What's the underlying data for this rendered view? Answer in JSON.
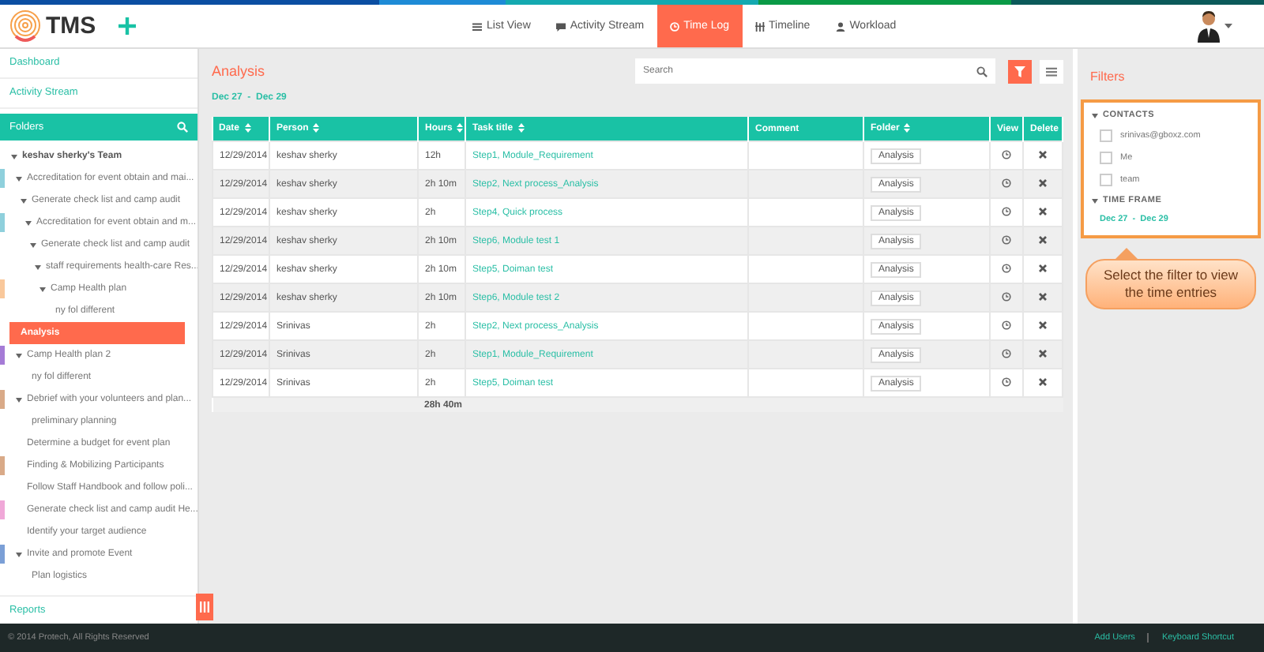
{
  "top_nav": {
    "logo_text": "TMS",
    "items": [
      {
        "label": "List View",
        "selected": false
      },
      {
        "label": "Activity Stream",
        "selected": false
      },
      {
        "label": "Time Log",
        "selected": true
      },
      {
        "label": "Timeline",
        "selected": false
      },
      {
        "label": "Workload",
        "selected": false
      }
    ]
  },
  "sidebar": {
    "links": [
      "Dashboard",
      "Activity Stream"
    ],
    "folders_title": "Folders",
    "tree": [
      {
        "label": "keshav sherky's Team",
        "expanded": true,
        "selected": false,
        "children": [
          {
            "label": "Accreditation for event obtain and mai...",
            "expanded": true,
            "selected": false,
            "color": "#8fd0dc",
            "children": [
              {
                "label": "Generate check list and camp audit",
                "expanded": true,
                "selected": false,
                "children": [
                  {
                    "label": "Accreditation for event obtain and m...",
                    "expanded": true,
                    "selected": false,
                    "color": "#8fd0dc",
                    "children": [
                      {
                        "label": "Generate check list and camp audit",
                        "expanded": true,
                        "selected": false,
                        "children": [
                          {
                            "label": "staff requirements health-care Res...",
                            "expanded": true,
                            "selected": false,
                            "children": [
                              {
                                "label": "Camp Health plan",
                                "expanded": true,
                                "selected": false,
                                "color": "#f9c89b",
                                "children": [
                                  {
                                    "label": "ny fol different",
                                    "selected": false
                                  },
                                  {
                                    "label": "Analysis",
                                    "selected": true
                                  }
                                ]
                              }
                            ]
                          }
                        ]
                      }
                    ]
                  }
                ]
              }
            ]
          },
          {
            "label": "Camp Health plan 2",
            "expanded": true,
            "selected": false,
            "color": "#a57bd6",
            "children": [
              {
                "label": "ny fol different",
                "selected": false
              }
            ]
          },
          {
            "label": "Debrief with your volunteers and plan...",
            "expanded": true,
            "selected": false,
            "color": "#d9aa88",
            "children": [
              {
                "label": "preliminary planning",
                "selected": false
              }
            ]
          },
          {
            "label": "Determine a budget for event plan",
            "selected": false
          },
          {
            "label": "Finding & Mobilizing Participants",
            "selected": false,
            "color": "#d9aa88"
          },
          {
            "label": "Follow Staff Handbook and follow poli...",
            "selected": false
          },
          {
            "label": "Generate check list and camp audit He...",
            "selected": false,
            "color": "#f0a8d8"
          },
          {
            "label": "Identify your target audience",
            "selected": false
          },
          {
            "label": "Invite and promote Event",
            "expanded": true,
            "selected": false,
            "color": "#7b9fd6",
            "children": [
              {
                "label": "Plan logistics",
                "selected": false
              }
            ]
          }
        ]
      }
    ],
    "footer_link": "Reports"
  },
  "main": {
    "title": "Analysis",
    "date_range": "Dec 27  -  Dec 29",
    "search": {
      "placeholder": "Search"
    },
    "table": {
      "columns": [
        {
          "label": "Date",
          "sortable": true
        },
        {
          "label": "Person",
          "sortable": true
        },
        {
          "label": "Hours",
          "sortable": true
        },
        {
          "label": "Task title",
          "sortable": true
        },
        {
          "label": "Comment",
          "sortable": false
        },
        {
          "label": "Folder",
          "sortable": true
        },
        {
          "label": "View",
          "sortable": false
        },
        {
          "label": "Delete",
          "sortable": false
        }
      ],
      "rows": [
        {
          "date": "12/29/2014",
          "person": "keshav sherky",
          "hours": "12h",
          "task": "Step1, Module_Requirement",
          "folder": "Analysis"
        },
        {
          "date": "12/29/2014",
          "person": "keshav sherky",
          "hours": "2h 10m",
          "task": "Step2, Next process_Analysis",
          "folder": "Analysis"
        },
        {
          "date": "12/29/2014",
          "person": "keshav sherky",
          "hours": "2h",
          "task": "Step4, Quick process",
          "folder": "Analysis"
        },
        {
          "date": "12/29/2014",
          "person": "keshav sherky",
          "hours": "2h 10m",
          "task": "Step6, Module test 1",
          "folder": "Analysis"
        },
        {
          "date": "12/29/2014",
          "person": "keshav sherky",
          "hours": "2h 10m",
          "task": "Step5, Doiman test",
          "folder": "Analysis"
        },
        {
          "date": "12/29/2014",
          "person": "keshav sherky",
          "hours": "2h 10m",
          "task": "Step6, Module test 2",
          "folder": "Analysis"
        },
        {
          "date": "12/29/2014",
          "person": "Srinivas",
          "hours": "2h",
          "task": "Step2, Next process_Analysis",
          "folder": "Analysis"
        },
        {
          "date": "12/29/2014",
          "person": "Srinivas",
          "hours": "2h",
          "task": "Step1, Module_Requirement",
          "folder": "Analysis"
        },
        {
          "date": "12/29/2014",
          "person": "Srinivas",
          "hours": "2h",
          "task": "Step5, Doiman test",
          "folder": "Analysis"
        }
      ],
      "total": "28h 40m"
    }
  },
  "filters": {
    "title": "Filters",
    "sections": [
      {
        "title": "CONTACTS",
        "kind": "checkboxes",
        "expanded": true,
        "options": [
          {
            "label": "srinivas@gboxz.com",
            "checked": false
          },
          {
            "label": "Me",
            "checked": false
          },
          {
            "label": "team",
            "checked": false
          }
        ]
      },
      {
        "title": "TIME FRAME",
        "kind": "range",
        "expanded": true,
        "value": "Dec 27  -  Dec 29"
      }
    ],
    "callout": {
      "text": "Select the filter to view the time entries"
    }
  },
  "footer": {
    "copyright": "© 2014 Protech, All Rights Reserved",
    "links": [
      "Add Users",
      "Keyboard Shortcut"
    ]
  }
}
